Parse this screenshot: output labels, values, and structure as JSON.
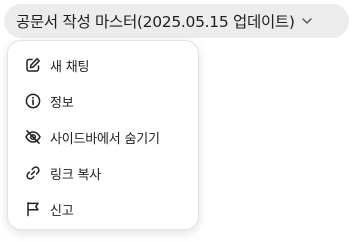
{
  "header": {
    "title": "공문서 작성 마스터(2025.05.15 업데이트)",
    "chevron_icon": "chevron-down-icon"
  },
  "menu": {
    "items": [
      {
        "label": "새 채팅",
        "icon": "edit-icon"
      },
      {
        "label": "정보",
        "icon": "info-icon"
      },
      {
        "label": "사이드바에서 숨기기",
        "icon": "eye-off-icon"
      },
      {
        "label": "링크 복사",
        "icon": "link-icon"
      },
      {
        "label": "신고",
        "icon": "flag-icon"
      }
    ]
  }
}
